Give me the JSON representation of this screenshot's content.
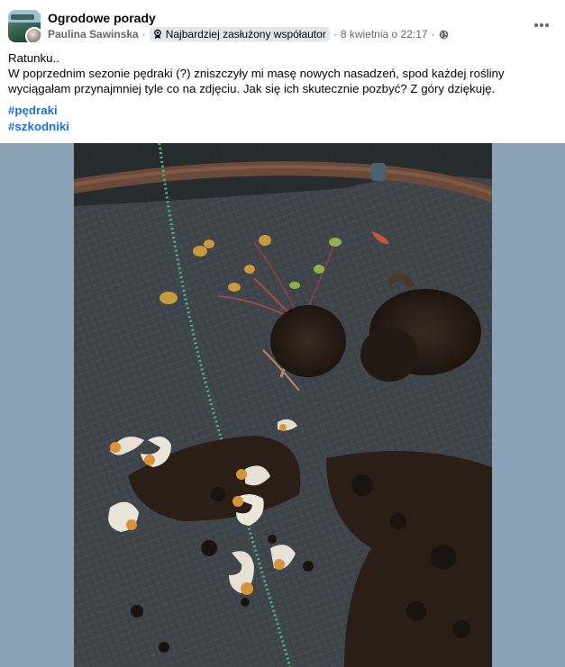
{
  "post": {
    "group_name": "Ogrodowe porady",
    "author": "Paulina Sawinska",
    "badge": "Najbardziej zasłużony współautor",
    "timestamp": "8 kwietnia o 22:17",
    "separator": "·",
    "text_lines": [
      "Ratunku..",
      "W poprzednim sezonie pędraki (?) zniszczyły mi masę nowych nasadzeń, spod każdej rośliny wyciągałam przynajmniej tyle co na zdjęciu. Jak się ich skutecznie pozbyć? Z góry dziękuję."
    ],
    "hashtags": [
      "#pędraki",
      "#szkodniki"
    ]
  },
  "icons": {
    "more": "more-horizontal-icon",
    "badge": "award-icon",
    "audience": "globe-icon"
  },
  "colors": {
    "hashtag": "#216fdb",
    "meta_text": "#65676b",
    "badge_bg": "#e4e6eb",
    "media_bg": "#8aa2b6"
  }
}
